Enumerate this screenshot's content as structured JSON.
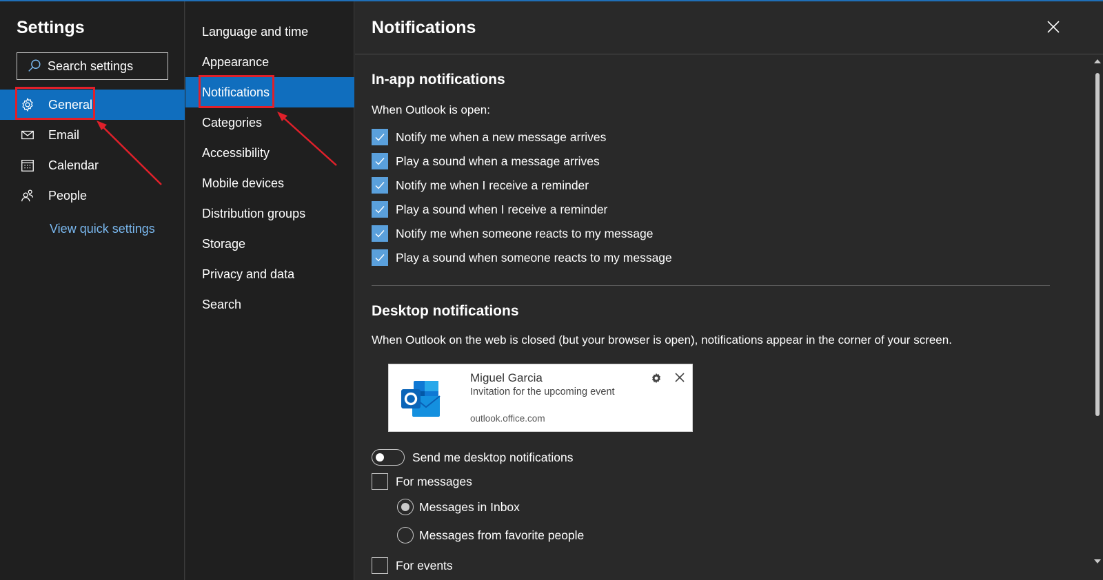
{
  "settings_title": "Settings",
  "search": {
    "placeholder": "Search settings"
  },
  "left_nav": [
    {
      "label": "General",
      "icon": "gear-icon",
      "active": true
    },
    {
      "label": "Email",
      "icon": "mail-icon",
      "active": false
    },
    {
      "label": "Calendar",
      "icon": "calendar-icon",
      "active": false
    },
    {
      "label": "People",
      "icon": "people-icon",
      "active": false
    }
  ],
  "view_quick_settings": "View quick settings",
  "mid_nav": [
    {
      "label": "Language and time",
      "active": false
    },
    {
      "label": "Appearance",
      "active": false
    },
    {
      "label": "Notifications",
      "active": true
    },
    {
      "label": "Categories",
      "active": false
    },
    {
      "label": "Accessibility",
      "active": false
    },
    {
      "label": "Mobile devices",
      "active": false
    },
    {
      "label": "Distribution groups",
      "active": false
    },
    {
      "label": "Storage",
      "active": false
    },
    {
      "label": "Privacy and data",
      "active": false
    },
    {
      "label": "Search",
      "active": false
    }
  ],
  "pane": {
    "title": "Notifications",
    "in_app": {
      "heading": "In-app notifications",
      "subheading": "When Outlook is open:",
      "options": [
        {
          "label": "Notify me when a new message arrives",
          "checked": true
        },
        {
          "label": "Play a sound when a message arrives",
          "checked": true
        },
        {
          "label": "Notify me when I receive a reminder",
          "checked": true
        },
        {
          "label": "Play a sound when I receive a reminder",
          "checked": true
        },
        {
          "label": "Notify me when someone reacts to my message",
          "checked": true
        },
        {
          "label": "Play a sound when someone reacts to my message",
          "checked": true
        }
      ]
    },
    "desktop": {
      "heading": "Desktop notifications",
      "description": "When Outlook on the web is closed (but your browser is open), notifications appear in the corner of your screen.",
      "preview": {
        "sender": "Miguel Garcia",
        "message": "Invitation for the upcoming event",
        "source": "outlook.office.com"
      },
      "toggle_label": "Send me desktop notifications",
      "toggle_on": false,
      "for_messages": {
        "label": "For messages",
        "checked": false
      },
      "message_options": [
        {
          "label": "Messages in Inbox",
          "selected": true
        },
        {
          "label": "Messages from favorite people",
          "selected": false
        }
      ],
      "for_events": {
        "label": "For events",
        "checked": false
      }
    }
  },
  "colors": {
    "accent": "#106ebe",
    "highlight": "#e0202a",
    "link": "#7ab8ef",
    "checkbox": "#5aa0dc"
  }
}
